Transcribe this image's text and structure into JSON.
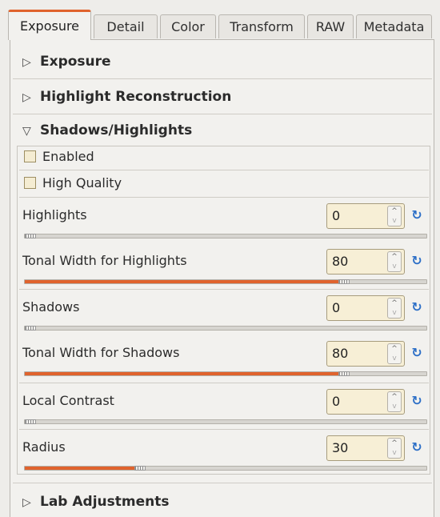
{
  "tabs": [
    {
      "label": "Exposure",
      "active": true
    },
    {
      "label": "Detail"
    },
    {
      "label": "Color"
    },
    {
      "label": "Transform"
    },
    {
      "label": "RAW"
    },
    {
      "label": "Metadata"
    }
  ],
  "sections": {
    "exposure": {
      "title": "Exposure",
      "arrow": "▷"
    },
    "highlight_reconstruction": {
      "title": "Highlight Reconstruction",
      "arrow": "▷"
    },
    "shadows_highlights": {
      "title": "Shadows/Highlights",
      "arrow": "▽"
    },
    "lab_adjustments": {
      "title": "Lab Adjustments",
      "arrow": "▷"
    }
  },
  "checkboxes": {
    "enabled": {
      "label": "Enabled",
      "checked": false
    },
    "high_quality": {
      "label": "High Quality",
      "checked": false
    }
  },
  "adjusters": {
    "highlights": {
      "label": "Highlights",
      "value": "0",
      "fraction": 0.0
    },
    "tonal_width_highlights": {
      "label": "Tonal Width for Highlights",
      "value": "80",
      "fraction": 0.8
    },
    "shadows": {
      "label": "Shadows",
      "value": "0",
      "fraction": 0.0
    },
    "tonal_width_shadows": {
      "label": "Tonal Width for Shadows",
      "value": "80",
      "fraction": 0.8
    },
    "local_contrast": {
      "label": "Local Contrast",
      "value": "0",
      "fraction": 0.0
    },
    "radius": {
      "label": "Radius",
      "value": "30",
      "fraction": 0.28
    }
  },
  "icons": {
    "spin_up": "^",
    "spin_down": "v",
    "reset": "↻"
  },
  "colors": {
    "accent": "#e0632d",
    "reset_icon": "#2d6fc7",
    "field_bg": "#f7efd6"
  }
}
